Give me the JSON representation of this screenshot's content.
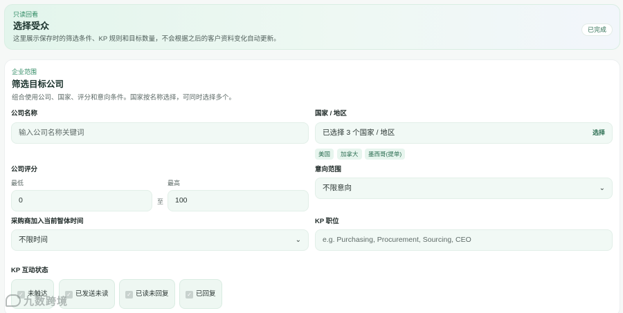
{
  "banner": {
    "eyebrow": "只读回看",
    "title": "选择受众",
    "description": "这里展示保存时的筛选条件、KP 规则和目标数量，不会根据之后的客户资料变化自动更新。",
    "status_badge": "已完成"
  },
  "card": {
    "eyebrow": "企业范围",
    "title": "筛选目标公司",
    "description": "组合使用公司、国家、评分和意向条件。国家按名称选择，可同时选择多个。"
  },
  "company_name": {
    "label": "公司名称",
    "placeholder": "输入公司名称关键词"
  },
  "country": {
    "label": "国家 / 地区",
    "value": "已选择 3 个国家 / 地区",
    "select_label": "选择",
    "tags": [
      "美国",
      "加拿大",
      "墨西哥(提单)"
    ]
  },
  "rating": {
    "label": "公司评分",
    "min_label": "最低",
    "max_label": "最高",
    "min_value": "0",
    "separator": "至",
    "max_value": "100"
  },
  "intent": {
    "label": "意向范围",
    "value": "不限意向"
  },
  "buyer_time": {
    "label": "采购商加入当前智体时间",
    "value": "不限时间"
  },
  "kp_title": {
    "label": "KP 职位",
    "placeholder": "e.g. Purchasing, Procurement, Sourcing, CEO"
  },
  "kp_status": {
    "label": "KP 互动状态",
    "options": [
      "未触达",
      "已发送未读",
      "已读未回复",
      "已回复"
    ]
  },
  "watermark": "九数跨境",
  "icons": {
    "chevron": "chevron-down-icon",
    "checkbox": "check-icon"
  },
  "colors": {
    "accent": "#2f8a63",
    "field_bg": "#f1f9f5"
  }
}
